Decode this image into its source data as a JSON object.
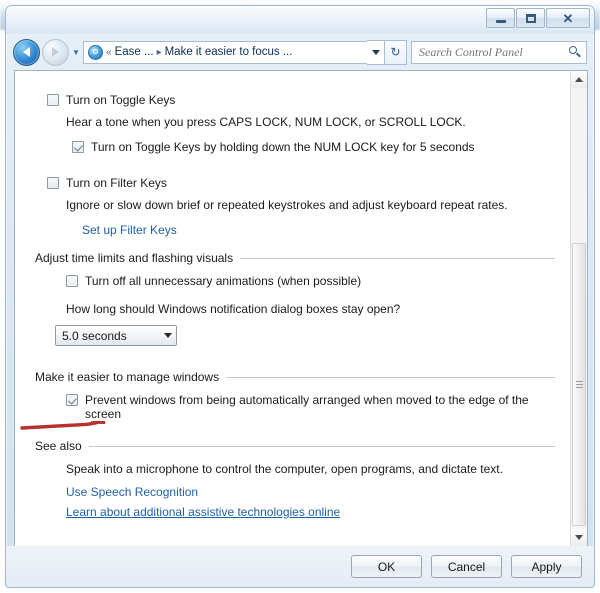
{
  "window": {
    "controls": {
      "minimize_label": "Minimize",
      "maximize_label": "Maximize",
      "close_label": "Close",
      "close_glyph": "✕"
    }
  },
  "nav": {
    "back_label": "Back",
    "forward_label": "Forward",
    "history_label": "Recent pages",
    "breadcrumb": {
      "overflow": "«",
      "items": [
        "Ease ...",
        "Make it easier to focus ..."
      ],
      "separator": "▸"
    },
    "refresh_glyph": "↻",
    "search": {
      "placeholder": "Search Control Panel",
      "value": ""
    }
  },
  "content": {
    "toggle_keys": {
      "label": "Turn on Toggle Keys",
      "checked": false,
      "description": "Hear a tone when you press CAPS LOCK, NUM LOCK, or SCROLL LOCK.",
      "sub_option": {
        "label": "Turn on Toggle Keys by holding down the NUM LOCK key for 5 seconds",
        "checked": true
      }
    },
    "filter_keys": {
      "label": "Turn on Filter Keys",
      "checked": false,
      "description": "Ignore or slow down brief or repeated keystrokes and adjust keyboard repeat rates.",
      "link": "Set up Filter Keys"
    },
    "time_limits": {
      "heading": "Adjust time limits and flashing visuals",
      "animations": {
        "label": "Turn off all unnecessary animations (when possible)",
        "checked": false
      },
      "question": "How long should Windows notification dialog boxes stay open?",
      "duration_value": "5.0 seconds"
    },
    "manage_windows": {
      "heading": "Make it easier to manage windows",
      "prevent_arrange": {
        "label": "Prevent windows from being automatically arranged when moved to the edge of the screen",
        "checked": true
      }
    },
    "see_also": {
      "heading": "See also",
      "description": "Speak into a microphone to control the computer, open programs, and dictate text.",
      "links": [
        "Use Speech Recognition",
        "Learn about additional assistive technologies online"
      ]
    }
  },
  "annotation": {
    "color": "#b5322f"
  },
  "buttons": {
    "ok": "OK",
    "cancel": "Cancel",
    "apply": "Apply"
  }
}
